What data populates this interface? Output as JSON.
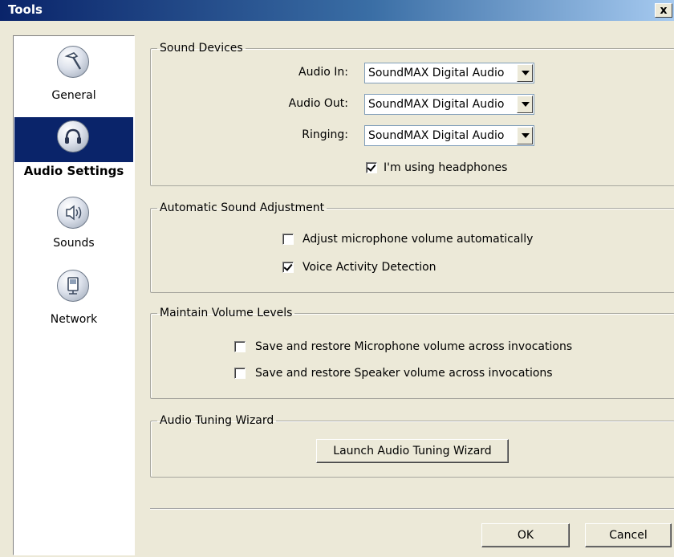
{
  "window": {
    "title": "Tools",
    "close_label": "x"
  },
  "sidebar": {
    "items": [
      {
        "label": "General",
        "icon": "hammer-icon",
        "selected": false
      },
      {
        "label": "Audio Settings",
        "icon": "headphones-icon",
        "selected": true
      },
      {
        "label": "Sounds",
        "icon": "speaker-icon",
        "selected": false
      },
      {
        "label": "Network",
        "icon": "network-icon",
        "selected": false
      }
    ]
  },
  "sound_devices": {
    "legend": "Sound Devices",
    "audio_in_label": "Audio In:",
    "audio_in_value": "SoundMAX Digital Audio",
    "audio_out_label": "Audio Out:",
    "audio_out_value": "SoundMAX Digital Audio",
    "ringing_label": "Ringing:",
    "ringing_value": "SoundMAX Digital Audio",
    "headphones_label": "I'm using headphones",
    "headphones_checked": true
  },
  "auto_adjust": {
    "legend": "Automatic Sound Adjustment",
    "adjust_mic_label": "Adjust microphone volume automatically",
    "adjust_mic_checked": false,
    "vad_label": "Voice Activity Detection",
    "vad_checked": true
  },
  "volume_levels": {
    "legend": "Maintain Volume Levels",
    "mic_restore_label": "Save and restore Microphone volume across invocations",
    "mic_restore_checked": false,
    "speaker_restore_label": "Save and restore Speaker volume across invocations",
    "speaker_restore_checked": false
  },
  "tuning": {
    "legend": "Audio Tuning Wizard",
    "launch_label": "Launch Audio Tuning Wizard"
  },
  "footer": {
    "ok_label": "OK",
    "cancel_label": "Cancel"
  }
}
